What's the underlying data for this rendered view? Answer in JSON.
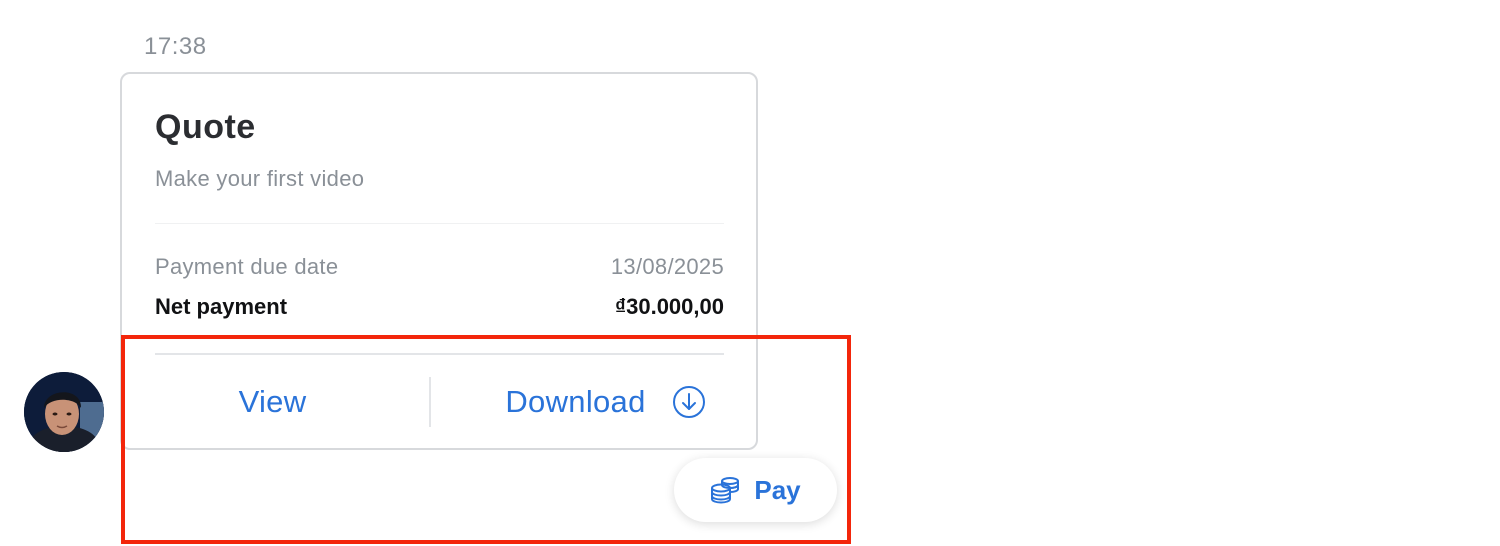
{
  "message": {
    "timestamp": "17:38"
  },
  "quote_card": {
    "title": "Quote",
    "subtitle": "Make your first video",
    "due_date_label": "Payment due date",
    "due_date_value": "13/08/2025",
    "net_payment_label": "Net payment",
    "net_payment_value": "₫30.000,00",
    "view_label": "View",
    "download_label": "Download",
    "download_icon": "download-circle-icon"
  },
  "pay_button": {
    "label": "Pay",
    "icon": "coins-icon"
  },
  "colors": {
    "accent": "#2a73d9",
    "highlight": "#f3260b"
  }
}
